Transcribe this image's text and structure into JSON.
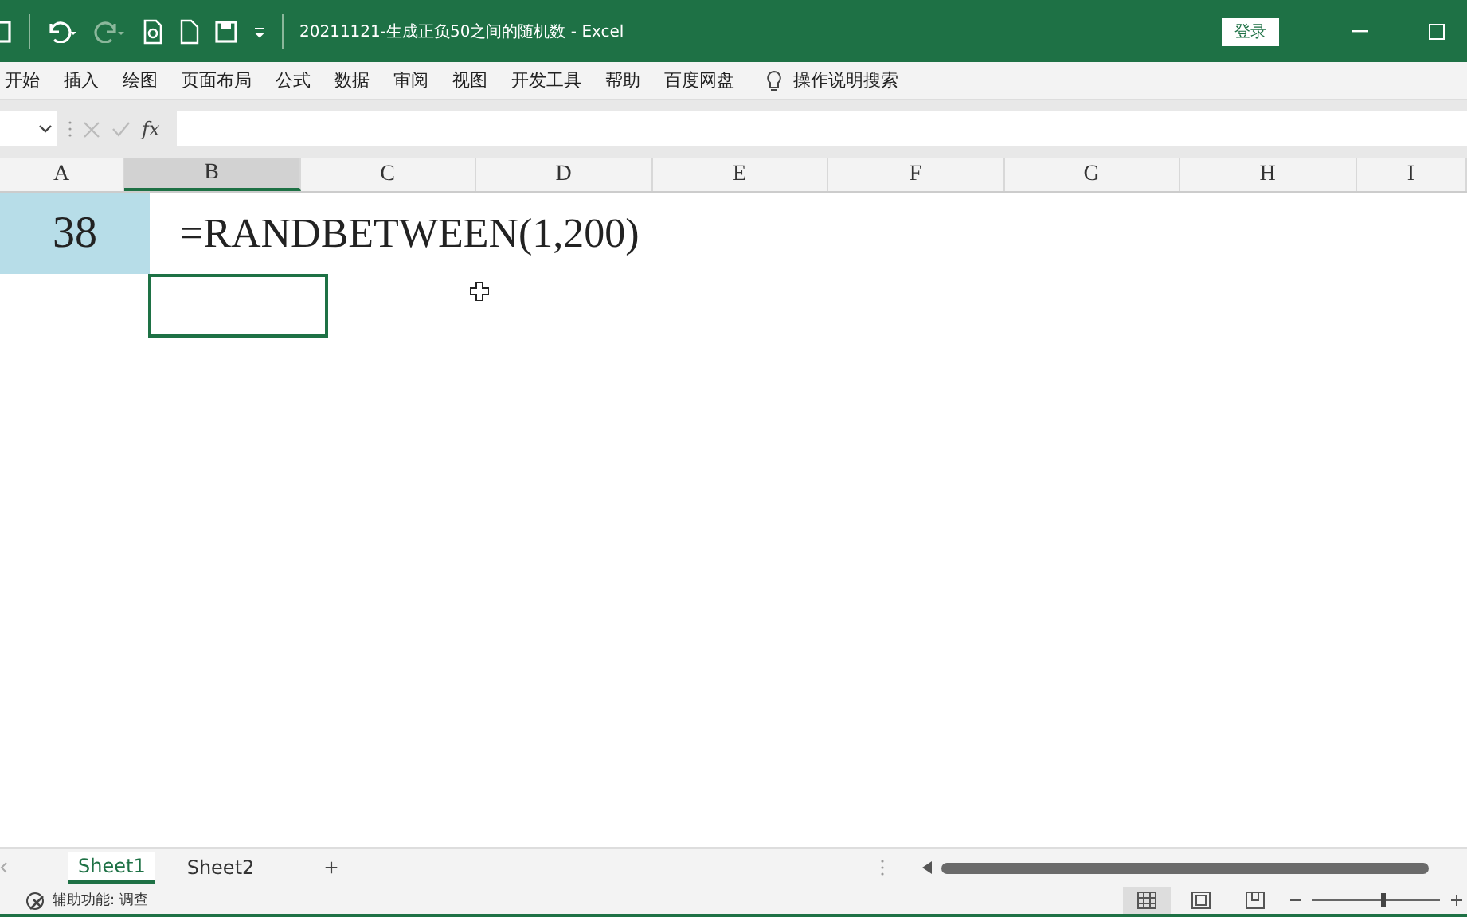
{
  "title_bar": {
    "file_title": "20211121-生成正负50之间的随机数  -  Excel",
    "sign_in": "登录"
  },
  "ribbon_tabs": [
    "开始",
    "插入",
    "绘图",
    "页面布局",
    "公式",
    "数据",
    "审阅",
    "视图",
    "开发工具",
    "帮助",
    "百度网盘"
  ],
  "tell_me": "操作说明搜索",
  "formula_bar": {
    "fx": "fx"
  },
  "columns": [
    {
      "label": "A",
      "selected": false
    },
    {
      "label": "B",
      "selected": true
    },
    {
      "label": "C",
      "selected": false
    },
    {
      "label": "D",
      "selected": false
    },
    {
      "label": "E",
      "selected": false
    },
    {
      "label": "F",
      "selected": false
    },
    {
      "label": "G",
      "selected": false
    },
    {
      "label": "H",
      "selected": false
    },
    {
      "label": "I",
      "selected": false
    }
  ],
  "cells": {
    "a1": "38",
    "b1": "=RANDBETWEEN(1,200)"
  },
  "sheet_tabs": [
    {
      "label": "Sheet1",
      "selected": true
    },
    {
      "label": "Sheet2",
      "selected": false
    }
  ],
  "add_sheet": "+",
  "status_bar": {
    "accessibility": "辅助功能: 调查",
    "views": [
      {
        "kind": "normal",
        "selected": true
      },
      {
        "kind": "page-layout",
        "selected": false
      },
      {
        "kind": "page-break",
        "selected": false
      }
    ],
    "zoom": {
      "level": 0.55
    }
  }
}
